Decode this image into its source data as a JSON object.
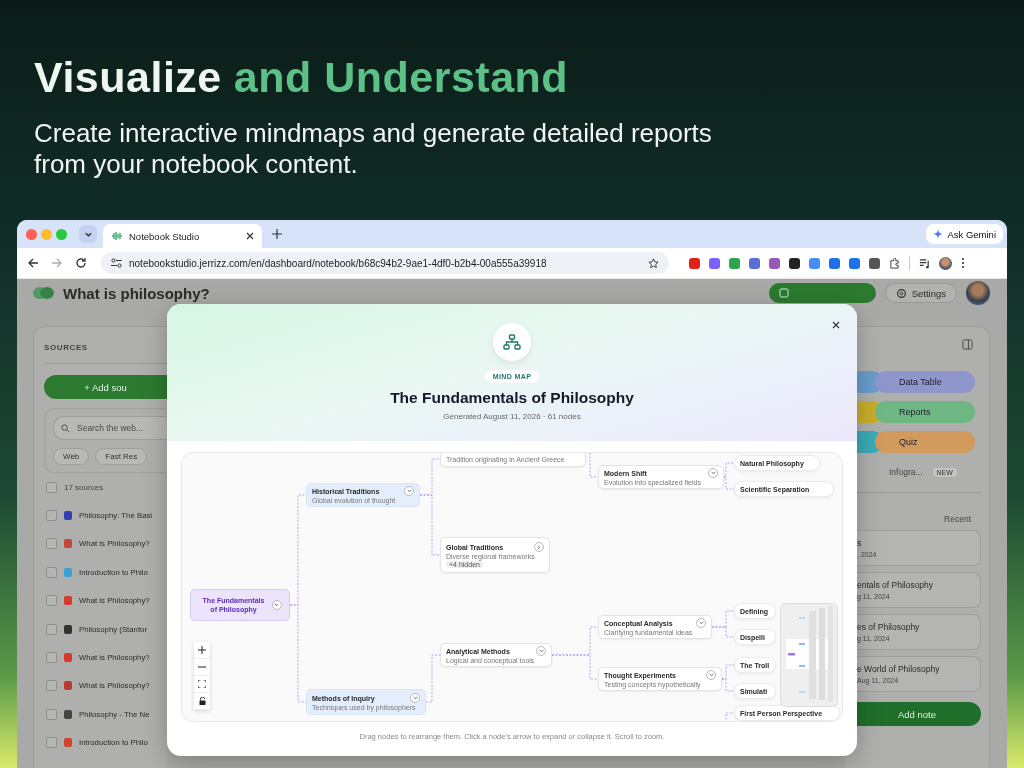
{
  "hero": {
    "headline": [
      {
        "text": "Visualize",
        "accent": false
      },
      {
        "text": "and Understand",
        "accent": true
      }
    ],
    "subtitle": "Create interactive mindmaps and generate detailed reports from your notebook content."
  },
  "browser": {
    "tab_title": "Notebook Studio",
    "url": "notebookstudio.jerrizz.com/en/dashboard/notebook/b68c94b2-9ae1-4df0-b2b4-00a555a39918",
    "gemini_button": "Ask Gemini"
  },
  "app": {
    "title": "What is philosophy?",
    "settings_button": "Settings",
    "sources": {
      "heading": "SOURCES",
      "add_button": "+ Add sou",
      "search_placeholder": "Search the web...",
      "filters": [
        "Web",
        "Fast Res"
      ],
      "count": "17 sources",
      "all_checked": false,
      "items": [
        {
          "title": "Philosophy: The Basi",
          "color": "#2f3fb0",
          "checked": false
        },
        {
          "title": "What is Philosophy?",
          "color": "#c8453a",
          "checked": false
        },
        {
          "title": "Introduction to Philo",
          "color": "#3aa0d8",
          "checked": false
        },
        {
          "title": "What is Philosophy?",
          "color": "#d23a2a",
          "checked": false
        },
        {
          "title": "Philosophy (Stanfor",
          "color": "#333333",
          "checked": false
        },
        {
          "title": "What is Philosophy?",
          "color": "#d9382b",
          "checked": false
        },
        {
          "title": "What is Philosophy?",
          "color": "#b83a30",
          "checked": false
        },
        {
          "title": "Philosophy - The Ne",
          "color": "#444444",
          "checked": false
        },
        {
          "title": "Introduction to Philo",
          "color": "#d2452a",
          "checked": false
        }
      ]
    },
    "studio": {
      "tools": [
        {
          "color": "#6a9ccc"
        },
        {
          "label": "Data Table",
          "color": "#8f96cc"
        },
        {
          "color": "#c8ad2c"
        },
        {
          "label": "Reports",
          "color": "#6fb883"
        },
        {
          "color": "#3aabb8"
        },
        {
          "label": "Quiz",
          "color": "#d39a5e"
        }
      ],
      "infographic": {
        "label": "Infogra...",
        "badge": "NEW"
      },
      "sort": "Recent",
      "notes": [
        {
          "title": "s",
          "date": ", 2024"
        },
        {
          "title": "entals of Philosophy",
          "date": "g 11, 2024"
        },
        {
          "title": "es of Philosophy",
          "date": "g 11, 2024"
        },
        {
          "title": "e World of Philosophy",
          "date": "Aug 11, 2024"
        }
      ],
      "add_note": "Add note"
    }
  },
  "modal": {
    "badge": "MIND MAP",
    "title": "The Fundamentals of Philosophy",
    "meta": "Generated August 11, 2026 · 61 nodes",
    "hint": "Drag nodes to rearrange them. Click a node's arrow to expand or collapse it. Scroll to zoom.",
    "map": {
      "root": {
        "kind": "root",
        "title": "The Fundamentals of Philosophy",
        "expanded": true,
        "children": [
          {
            "kind": "branch",
            "title": "Historical Traditions",
            "subtitle": "Global evolution of thought",
            "expanded": true,
            "children": [
              {
                "kind": "topic",
                "subtitle": "Tradition originating in Ancient Greece"
              },
              {
                "kind": "topic",
                "title": "Global Traditions",
                "subtitle": "Diverse regional frameworks",
                "hidden": "+4 hidden",
                "expanded": false
              }
            ]
          },
          {
            "kind": "branch",
            "title": "Methods of Inquiry",
            "subtitle": "Techniques used by philosophers",
            "expanded": true,
            "children": [
              {
                "kind": "topic",
                "title": "Analytical Methods",
                "subtitle": "Logical and conceptual tools",
                "expanded": true,
                "children": [
                  {
                    "kind": "topic",
                    "title": "Conceptual Analysis",
                    "subtitle": "Clarifying fundamental ideas",
                    "expanded": true,
                    "children": [
                      {
                        "kind": "leaf",
                        "title": "Defining"
                      },
                      {
                        "kind": "leaf",
                        "title": "Dispelli"
                      }
                    ]
                  },
                  {
                    "kind": "topic",
                    "title": "Thought Experiments",
                    "subtitle": "Testing concepts hypothetically",
                    "expanded": true,
                    "children": [
                      {
                        "kind": "leaf",
                        "title": "The Troll"
                      },
                      {
                        "kind": "leaf",
                        "title": "Simulati"
                      }
                    ]
                  }
                ]
              }
            ]
          }
        ]
      },
      "loose": [
        {
          "kind": "topic",
          "title": "Modern Shift",
          "subtitle": "Evolution into specialized fields",
          "expanded": true,
          "children": [
            {
              "kind": "leaf",
              "title": "Natural Philosophy"
            },
            {
              "kind": "leaf",
              "title": "Scientific Separation"
            }
          ]
        },
        {
          "kind": "leaf",
          "title": "First Person Perspective"
        }
      ]
    }
  }
}
